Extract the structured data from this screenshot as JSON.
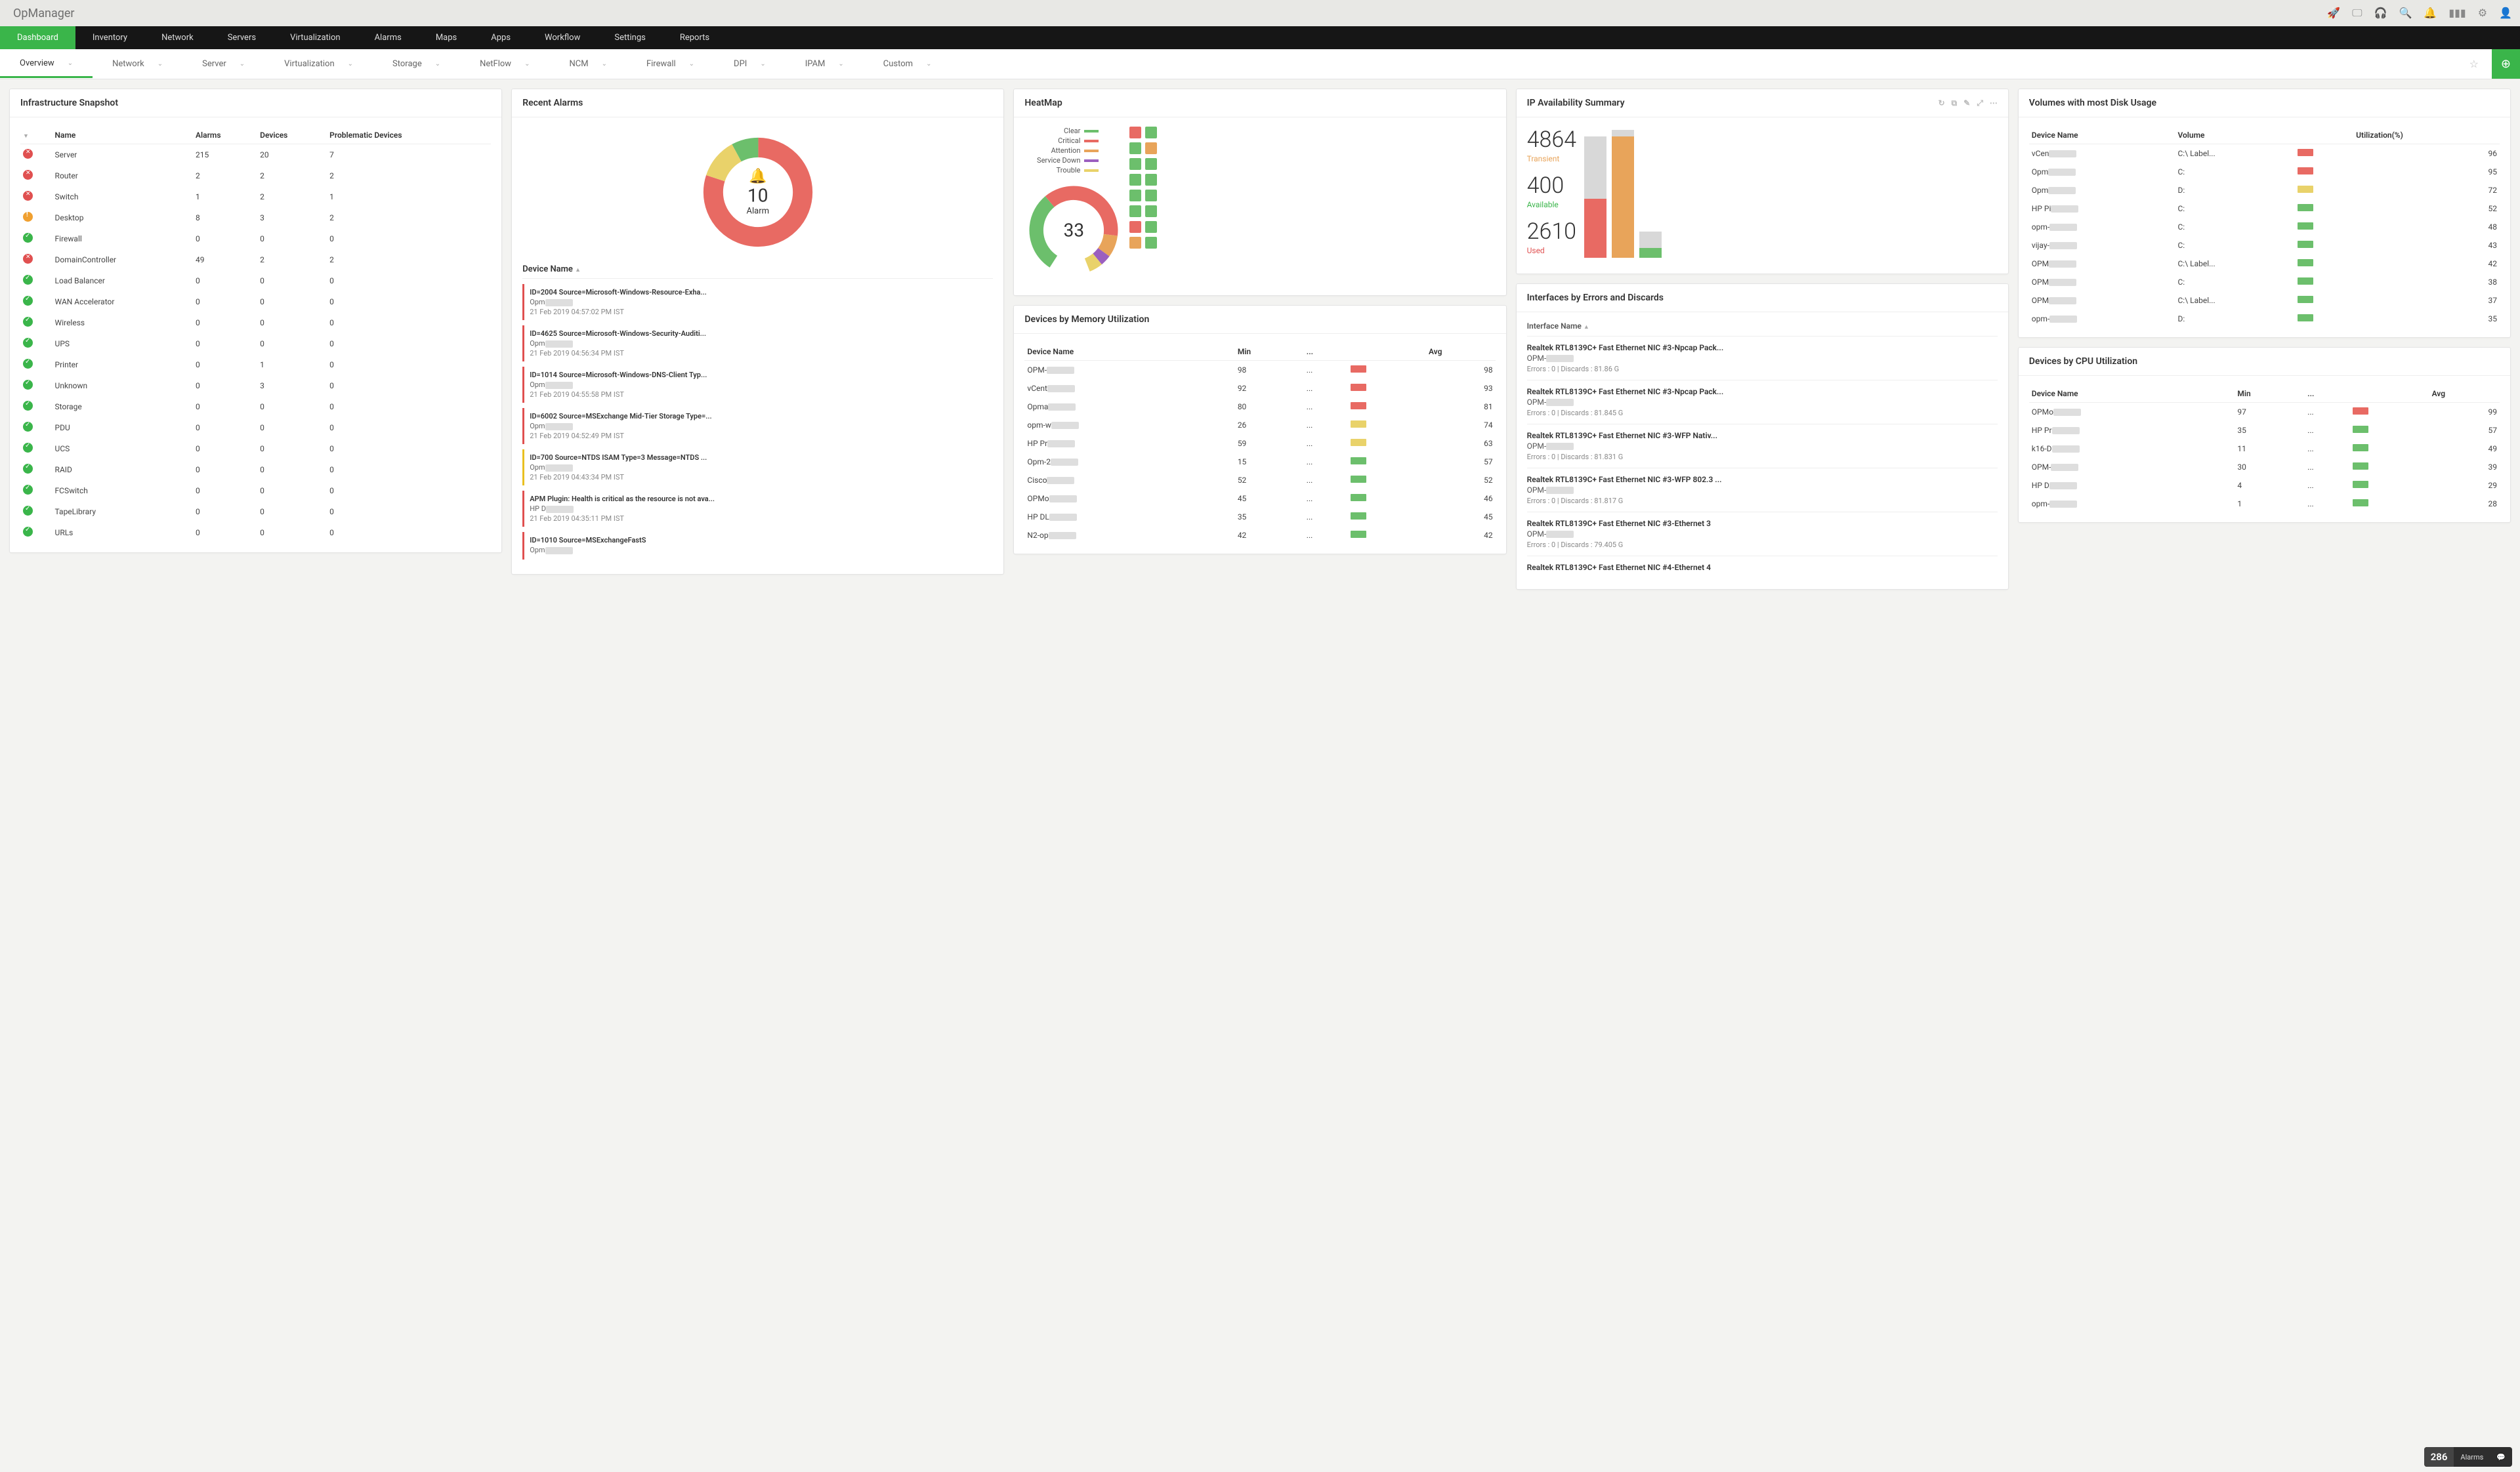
{
  "brand": "OpManager",
  "topIcons": [
    "rocket",
    "screen",
    "headset",
    "search",
    "bell",
    "barcode",
    "gear",
    "user"
  ],
  "mainnav": [
    "Dashboard",
    "Inventory",
    "Network",
    "Servers",
    "Virtualization",
    "Alarms",
    "Maps",
    "Apps",
    "Workflow",
    "Settings",
    "Reports"
  ],
  "subnav": [
    "Overview",
    "Network",
    "Server",
    "Virtualization",
    "Storage",
    "NetFlow",
    "NCM",
    "Firewall",
    "DPI",
    "IPAM",
    "Custom"
  ],
  "heatmap": {
    "title": "HeatMap",
    "legend": [
      "Clear",
      "Critical",
      "Attention",
      "Service Down",
      "Trouble"
    ],
    "center": "33",
    "grid": [
      [
        "red",
        "green"
      ],
      [
        "green",
        "orange"
      ],
      [
        "green",
        "green"
      ],
      [
        "green",
        "green"
      ],
      [
        "green",
        "green"
      ],
      [
        "green",
        "green"
      ],
      [
        "red",
        "green"
      ],
      [
        "orange",
        "green"
      ]
    ]
  },
  "ipavail": {
    "title": "IP Availability Summary",
    "stats": [
      {
        "n": "4864",
        "l": "Transient",
        "c": "orange-t"
      },
      {
        "n": "400",
        "l": "Available",
        "c": "green-t"
      },
      {
        "n": "2610",
        "l": "Used",
        "c": "red-t"
      }
    ]
  },
  "memory": {
    "title": "Devices by Memory Utilization",
    "cols": [
      "Device Name",
      "Min",
      "...",
      "",
      "Avg"
    ],
    "rows": [
      {
        "n": "OPM-",
        "min": "98",
        "avg": "98",
        "c": "red"
      },
      {
        "n": "vCent",
        "min": "92",
        "avg": "93",
        "c": "red"
      },
      {
        "n": "Opma",
        "min": "80",
        "avg": "81",
        "c": "red"
      },
      {
        "n": "opm-w",
        "min": "26",
        "avg": "74",
        "c": "yellow"
      },
      {
        "n": "HP Pr",
        "min": "59",
        "avg": "63",
        "c": "yellow"
      },
      {
        "n": "Opm-2",
        "min": "15",
        "avg": "57",
        "c": "green"
      },
      {
        "n": "Cisco",
        "min": "52",
        "avg": "52",
        "c": "green"
      },
      {
        "n": "OPMo",
        "min": "45",
        "avg": "46",
        "c": "green"
      },
      {
        "n": "HP DL",
        "min": "35",
        "avg": "45",
        "c": "green"
      },
      {
        "n": "N2-op",
        "min": "42",
        "avg": "42",
        "c": "green"
      }
    ]
  },
  "ifaces": {
    "title": "Interfaces by Errors and Discards",
    "col": "Interface Name",
    "rows": [
      {
        "n": "Realtek RTL8139C+ Fast Ethernet NIC #3-Npcap Pack...",
        "d": "OPM-",
        "s": "Errors : 0 | Discards : 81.86 G"
      },
      {
        "n": "Realtek RTL8139C+ Fast Ethernet NIC #3-Npcap Pack...",
        "d": "OPM-",
        "s": "Errors : 0 | Discards : 81.845 G"
      },
      {
        "n": "Realtek RTL8139C+ Fast Ethernet NIC #3-WFP Nativ...",
        "d": "OPM-",
        "s": "Errors : 0 | Discards : 81.831 G"
      },
      {
        "n": "Realtek RTL8139C+ Fast Ethernet NIC #3-WFP 802.3 ...",
        "d": "OPM-",
        "s": "Errors : 0 | Discards : 81.817 G"
      },
      {
        "n": "Realtek RTL8139C+ Fast Ethernet NIC #3-Ethernet 3",
        "d": "OPM-",
        "s": "Errors : 0 | Discards : 79.405 G"
      },
      {
        "n": "Realtek RTL8139C+ Fast Ethernet NIC #4-Ethernet 4",
        "d": "",
        "s": ""
      }
    ]
  },
  "infra": {
    "title": "Infrastructure Snapshot",
    "cols": [
      "",
      "Name",
      "Alarms",
      "Devices",
      "Problematic Devices"
    ],
    "rows": [
      {
        "i": "err",
        "n": "Server",
        "a": "215",
        "d": "20",
        "p": "7"
      },
      {
        "i": "err",
        "n": "Router",
        "a": "2",
        "d": "2",
        "p": "2"
      },
      {
        "i": "err",
        "n": "Switch",
        "a": "1",
        "d": "2",
        "p": "1"
      },
      {
        "i": "warn",
        "n": "Desktop",
        "a": "8",
        "d": "3",
        "p": "2"
      },
      {
        "i": "ok",
        "n": "Firewall",
        "a": "0",
        "d": "0",
        "p": "0"
      },
      {
        "i": "err",
        "n": "DomainController",
        "a": "49",
        "d": "2",
        "p": "2"
      },
      {
        "i": "ok",
        "n": "Load Balancer",
        "a": "0",
        "d": "0",
        "p": "0"
      },
      {
        "i": "ok",
        "n": "WAN Accelerator",
        "a": "0",
        "d": "0",
        "p": "0"
      },
      {
        "i": "ok",
        "n": "Wireless",
        "a": "0",
        "d": "0",
        "p": "0"
      },
      {
        "i": "ok",
        "n": "UPS",
        "a": "0",
        "d": "0",
        "p": "0"
      },
      {
        "i": "ok",
        "n": "Printer",
        "a": "0",
        "d": "1",
        "p": "0"
      },
      {
        "i": "ok",
        "n": "Unknown",
        "a": "0",
        "d": "3",
        "p": "0"
      },
      {
        "i": "ok",
        "n": "Storage",
        "a": "0",
        "d": "0",
        "p": "0"
      },
      {
        "i": "ok",
        "n": "PDU",
        "a": "0",
        "d": "0",
        "p": "0"
      },
      {
        "i": "ok",
        "n": "UCS",
        "a": "0",
        "d": "0",
        "p": "0"
      },
      {
        "i": "ok",
        "n": "RAID",
        "a": "0",
        "d": "0",
        "p": "0"
      },
      {
        "i": "ok",
        "n": "FCSwitch",
        "a": "0",
        "d": "0",
        "p": "0"
      },
      {
        "i": "ok",
        "n": "TapeLibrary",
        "a": "0",
        "d": "0",
        "p": "0"
      },
      {
        "i": "ok",
        "n": "URLs",
        "a": "0",
        "d": "0",
        "p": "0"
      }
    ]
  },
  "disk": {
    "title": "Volumes with most Disk Usage",
    "cols": [
      "Device Name",
      "Volume",
      "",
      "Utilization(%)"
    ],
    "rows": [
      {
        "n": "vCen",
        "v": "C:\\ Label...",
        "u": "96",
        "c": "red"
      },
      {
        "n": "Opm",
        "v": "C:",
        "u": "95",
        "c": "red"
      },
      {
        "n": "Opm",
        "v": "D:",
        "u": "72",
        "c": "yellow"
      },
      {
        "n": "HP Pi",
        "v": "C:",
        "u": "52",
        "c": "green"
      },
      {
        "n": "opm-",
        "v": "C:",
        "u": "48",
        "c": "green"
      },
      {
        "n": "vijay-",
        "v": "C:",
        "u": "43",
        "c": "green"
      },
      {
        "n": "OPM",
        "v": "C:\\ Label...",
        "u": "42",
        "c": "green"
      },
      {
        "n": "OPM",
        "v": "C:",
        "u": "38",
        "c": "green"
      },
      {
        "n": "OPM",
        "v": "C:\\ Label...",
        "u": "37",
        "c": "green"
      },
      {
        "n": "opm-",
        "v": "D:",
        "u": "35",
        "c": "green"
      }
    ]
  },
  "cpu": {
    "title": "Devices by CPU Utilization",
    "cols": [
      "Device Name",
      "Min",
      "...",
      "",
      "Avg"
    ],
    "rows": [
      {
        "n": "OPMo",
        "min": "97",
        "avg": "99",
        "c": "red"
      },
      {
        "n": "HP Pr",
        "min": "35",
        "avg": "57",
        "c": "green"
      },
      {
        "n": "k16-D",
        "min": "11",
        "avg": "49",
        "c": "green"
      },
      {
        "n": "OPM-",
        "min": "30",
        "avg": "39",
        "c": "green"
      },
      {
        "n": "HP D",
        "min": "4",
        "avg": "29",
        "c": "green"
      },
      {
        "n": "opm-",
        "min": "1",
        "avg": "28",
        "c": "green"
      }
    ]
  },
  "alarms": {
    "title": "Recent Alarms",
    "center_n": "10",
    "center_l": "Alarm",
    "colhead": "Device Name",
    "items": [
      {
        "t": "ID=2004 Source=Microsoft-Windows-Resource-Exha...",
        "d": "Opm",
        "ts": "21 Feb 2019 04:57:02 PM IST",
        "c": "red"
      },
      {
        "t": "ID=4625 Source=Microsoft-Windows-Security-Auditi...",
        "d": "Opm",
        "ts": "21 Feb 2019 04:56:34 PM IST",
        "c": "red"
      },
      {
        "t": "ID=1014 Source=Microsoft-Windows-DNS-Client Typ...",
        "d": "Opm",
        "ts": "21 Feb 2019 04:55:58 PM IST",
        "c": "red"
      },
      {
        "t": "ID=6002 Source=MSExchange Mid-Tier Storage Type=...",
        "d": "Opm",
        "ts": "21 Feb 2019 04:52:49 PM IST",
        "c": "red"
      },
      {
        "t": "ID=700 Source=NTDS ISAM Type=3 Message=NTDS ...",
        "d": "Opm",
        "ts": "21 Feb 2019 04:43:34 PM IST",
        "c": "yellow"
      },
      {
        "t": "APM Plugin: Health is critical as the resource is not ava...",
        "d": "HP D",
        "ts": "21 Feb 2019 04:35:11 PM IST",
        "c": "red"
      },
      {
        "t": "ID=1010 Source=MSExchangeFastS",
        "d": "Opm",
        "ts": "",
        "c": "red"
      }
    ]
  },
  "footer": {
    "n": "286",
    "l": "Alarms"
  },
  "chart_data": [
    {
      "type": "donut",
      "title": "HeatMap",
      "total": 33,
      "series": [
        {
          "name": "Critical",
          "value": 13,
          "color": "#e86a63"
        },
        {
          "name": "Attention",
          "value": 5,
          "color": "#e8a45a"
        },
        {
          "name": "Service Down",
          "value": 2,
          "color": "#9b5fbf"
        },
        {
          "name": "Trouble",
          "value": 3,
          "color": "#e9d26a"
        },
        {
          "name": "Clear",
          "value": 10,
          "color": "#6cbf6c"
        }
      ]
    },
    {
      "type": "bar",
      "title": "IP Availability Summary",
      "categories": [
        "Bar1",
        "Bar2",
        "Bar3"
      ],
      "series": [
        {
          "name": "Used",
          "color": "#e86a63",
          "values": [
            2200,
            0,
            0
          ]
        },
        {
          "name": "Transient",
          "color": "#e8a45a",
          "values": [
            0,
            4864,
            0
          ]
        },
        {
          "name": "Available",
          "color": "#6cbf6c",
          "values": [
            0,
            0,
            400
          ]
        },
        {
          "name": "Free",
          "color": "#d8d8d8",
          "values": [
            2800,
            200,
            4600
          ]
        }
      ],
      "ylim": [
        0,
        5000
      ]
    },
    {
      "type": "bar",
      "title": "Devices by Memory Utilization",
      "categories": [
        "OPM-",
        "vCent",
        "Opma",
        "opm-w",
        "HP Pr",
        "Opm-2",
        "Cisco",
        "OPMo",
        "HP DL",
        "N2-op"
      ],
      "series": [
        {
          "name": "Min",
          "values": [
            98,
            92,
            80,
            26,
            59,
            15,
            52,
            45,
            35,
            42
          ]
        },
        {
          "name": "Avg",
          "values": [
            98,
            93,
            81,
            74,
            63,
            57,
            52,
            46,
            45,
            42
          ]
        }
      ],
      "ylim": [
        0,
        100
      ]
    },
    {
      "type": "bar",
      "title": "Volumes with most Disk Usage",
      "categories": [
        "vCen C:",
        "Opm C:",
        "Opm D:",
        "HP Pi C:",
        "opm- C:",
        "vijay- C:",
        "OPM C:Label",
        "OPM C:",
        "OPM C:Label",
        "opm- D:"
      ],
      "values": [
        96,
        95,
        72,
        52,
        48,
        43,
        42,
        38,
        37,
        35
      ],
      "ylabel": "Utilization (%)",
      "ylim": [
        0,
        100
      ]
    },
    {
      "type": "bar",
      "title": "Devices by CPU Utilization",
      "categories": [
        "OPMo",
        "HP Pr",
        "k16-D",
        "OPM-",
        "HP D",
        "opm-"
      ],
      "series": [
        {
          "name": "Min",
          "values": [
            97,
            35,
            11,
            30,
            4,
            1
          ]
        },
        {
          "name": "Avg",
          "values": [
            99,
            57,
            49,
            39,
            29,
            28
          ]
        }
      ],
      "ylim": [
        0,
        100
      ]
    },
    {
      "type": "donut",
      "title": "Recent Alarms",
      "total": 10,
      "series": [
        {
          "name": "Critical",
          "value": 8,
          "color": "#e86a63"
        },
        {
          "name": "Trouble",
          "value": 1,
          "color": "#e9d26a"
        },
        {
          "name": "Clear",
          "value": 1,
          "color": "#6cbf6c"
        }
      ]
    },
    {
      "type": "table",
      "title": "Infrastructure Snapshot",
      "columns": [
        "Name",
        "Alarms",
        "Devices",
        "Problematic Devices"
      ],
      "rows": [
        [
          "Server",
          215,
          20,
          7
        ],
        [
          "Router",
          2,
          2,
          2
        ],
        [
          "Switch",
          1,
          2,
          1
        ],
        [
          "Desktop",
          8,
          3,
          2
        ],
        [
          "Firewall",
          0,
          0,
          0
        ],
        [
          "DomainController",
          49,
          2,
          2
        ],
        [
          "Load Balancer",
          0,
          0,
          0
        ],
        [
          "WAN Accelerator",
          0,
          0,
          0
        ],
        [
          "Wireless",
          0,
          0,
          0
        ],
        [
          "UPS",
          0,
          0,
          0
        ],
        [
          "Printer",
          0,
          1,
          0
        ],
        [
          "Unknown",
          0,
          3,
          0
        ],
        [
          "Storage",
          0,
          0,
          0
        ],
        [
          "PDU",
          0,
          0,
          0
        ],
        [
          "UCS",
          0,
          0,
          0
        ],
        [
          "RAID",
          0,
          0,
          0
        ],
        [
          "FCSwitch",
          0,
          0,
          0
        ],
        [
          "TapeLibrary",
          0,
          0,
          0
        ],
        [
          "URLs",
          0,
          0,
          0
        ]
      ]
    }
  ]
}
